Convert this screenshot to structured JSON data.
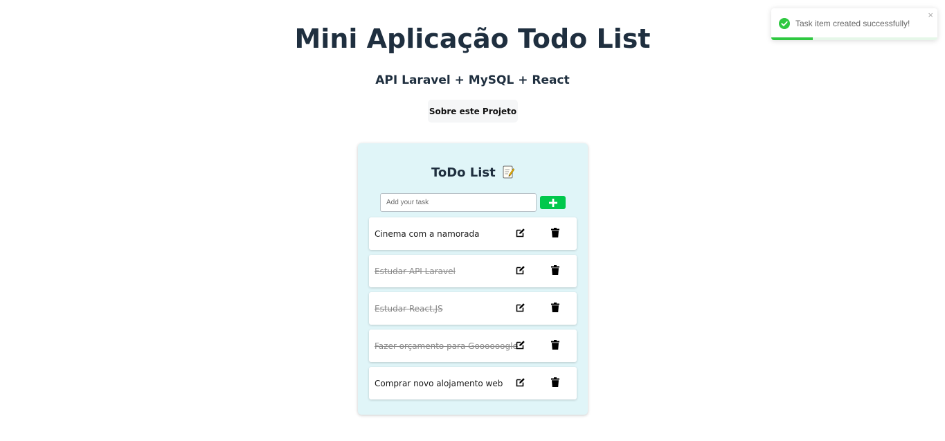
{
  "header": {
    "title": "Mini Aplicação Todo List",
    "subtitle": "API Laravel + MySQL + React",
    "about_button_label": "Sobre este Projeto"
  },
  "todo": {
    "title": "ToDo List",
    "title_icon": "memo-icon",
    "input": {
      "value": "",
      "placeholder": "Add your task"
    },
    "add_button_icon": "plus-icon",
    "items": [
      {
        "text": "Cinema com a namorada",
        "completed": false
      },
      {
        "text": "Estudar API Laravel",
        "completed": true
      },
      {
        "text": "Estudar React.JS",
        "completed": true
      },
      {
        "text": "Fazer orçamento para Goooooogle",
        "completed": true
      },
      {
        "text": "Comprar novo alojamento web",
        "completed": false
      }
    ],
    "edit_icon": "edit-icon",
    "delete_icon": "trash-icon"
  },
  "toast": {
    "message": "Task item created successfully!",
    "icon": "check-circle-icon",
    "close_label": "×",
    "progress": 0.25
  },
  "colors": {
    "title_text": "#1f2f3f",
    "card_background": "#e0f5f8",
    "add_button": "#00c84c",
    "toast_success": "#2ec840"
  }
}
